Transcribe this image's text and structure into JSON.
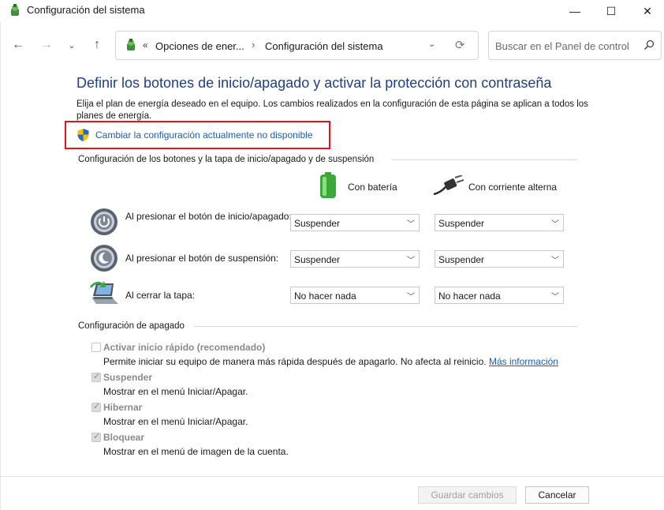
{
  "window": {
    "title": "Configuración del sistema",
    "minimize_glyph": "—",
    "maximize_glyph": "☐",
    "close_glyph": "✕"
  },
  "nav": {
    "back_glyph": "←",
    "forward_glyph": "→",
    "recent_glyph": "⌄",
    "up_glyph": "↑",
    "address_prefix": "«",
    "breadcrumb_1": "Opciones de ener...",
    "breadcrumb_sep": "›",
    "breadcrumb_2": "Configuración del sistema",
    "search_placeholder": "Buscar en el Panel de control"
  },
  "content": {
    "heading": "Definir los botones de inicio/apagado y activar la protección con contraseña",
    "description": "Elija el plan de energía deseado en el equipo. Los cambios realizados en la configuración de esta página se aplican a todos los planes de energía.",
    "change_link": "Cambiar la configuración actualmente no disponible",
    "buttons_section_title": "Configuración de los botones y la tapa de inicio/apagado y de suspensión",
    "col_battery": "Con batería",
    "col_ac": "Con corriente alterna",
    "rows": [
      {
        "label": "Al presionar el botón de inicio/apagado:",
        "battery": "Suspender",
        "ac": "Suspender",
        "icon": "power-button-icon"
      },
      {
        "label": "Al presionar el botón de suspensión:",
        "battery": "Suspender",
        "ac": "Suspender",
        "icon": "sleep-button-icon"
      },
      {
        "label": "Al cerrar la tapa:",
        "battery": "No hacer nada",
        "ac": "No hacer nada",
        "icon": "laptop-lid-icon"
      }
    ],
    "shutdown_section_title": "Configuración de apagado",
    "options": [
      {
        "label": "Activar inicio rápido (recomendado)",
        "desc": "Permite iniciar su equipo de manera más rápida después de apagarlo. No afecta al reinicio.",
        "link": "Más información",
        "checked": false
      },
      {
        "label": "Suspender",
        "desc": "Mostrar en el menú Iniciar/Apagar.",
        "checked": true
      },
      {
        "label": "Hibernar",
        "desc": "Mostrar en el menú Iniciar/Apagar.",
        "checked": true
      },
      {
        "label": "Bloquear",
        "desc": "Mostrar en el menú de imagen de la cuenta.",
        "checked": true
      }
    ]
  },
  "footer": {
    "save_label": "Guardar cambios",
    "cancel_label": "Cancelar"
  },
  "colors": {
    "heading": "#1e3f8a",
    "link": "#1a5fb4",
    "highlight": "#e0141e"
  }
}
